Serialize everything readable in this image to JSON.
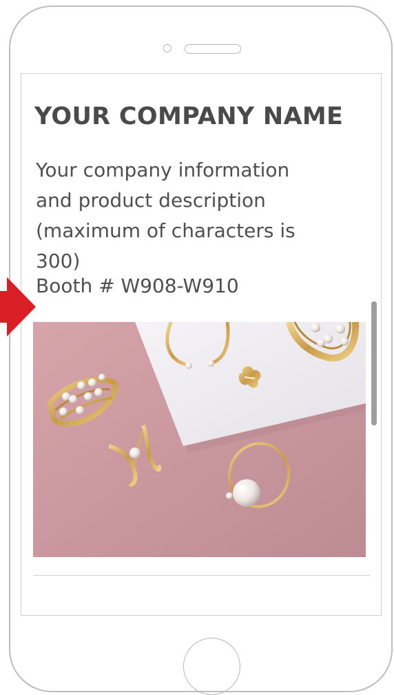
{
  "content": {
    "company_name": "YOUR COMPANY NAME",
    "description": "Your company information\nand product description\n(maximum of characters is\n300)",
    "booth": "Booth # W908-W910"
  },
  "colors": {
    "title_text": "#4a4a4a",
    "body_text": "#4f4f4f",
    "arrow": "#d91f25",
    "photo_background": "#c99aa0"
  },
  "icons": {
    "arrow": "right-arrow-icon"
  }
}
